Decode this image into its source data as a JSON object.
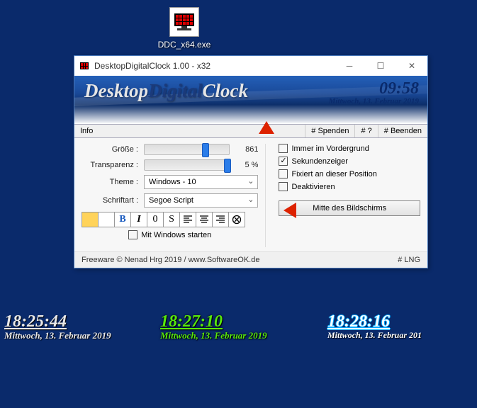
{
  "desktop_icon": {
    "label": "DDC_x64.exe"
  },
  "window": {
    "title": "DesktopDigitalClock 1.00 - x32",
    "banner": {
      "p1": "Desktop",
      "p2": "Digital",
      "p3": "Clock",
      "time": "09:58",
      "date": "Mittwoch, 13. Februar 2019"
    },
    "toolbar": {
      "info": "Info",
      "donate": "# Spenden",
      "help": "# ?",
      "exit": "# Beenden"
    },
    "controls": {
      "size_label": "Größe :",
      "size_value": "861",
      "size_pct": 68,
      "trans_label": "Transparenz :",
      "trans_value": "5 %",
      "trans_pct": 94,
      "theme_label": "Theme :",
      "theme_value": "Windows - 10",
      "font_label": "Schriftart :",
      "font_value": "Segoe Script",
      "style": {
        "B": "B",
        "I": "I",
        "zero": "0",
        "S": "S"
      },
      "start_label": "Mit Windows starten"
    },
    "options": {
      "foreground": "Immer im Vordergrund",
      "seconds": "Sekundenzeiger",
      "fixed": "Fixiert an dieser Position",
      "deactivate": "Deaktivieren",
      "center_btn": "Mitte des Bildschirms"
    },
    "footer": {
      "text": "Freeware © Nenad Hrg 2019 / www.SoftwareOK.de",
      "lng": "# LNG"
    }
  },
  "clocks": [
    {
      "time": "18:25:44",
      "date": "Mittwoch, 13. Februar 2019"
    },
    {
      "time": "18:27:10",
      "date": "Mittwoch, 13. Februar 2019"
    },
    {
      "time": "18:28:16",
      "date": "Mittwoch, 13. Februar 201"
    }
  ]
}
